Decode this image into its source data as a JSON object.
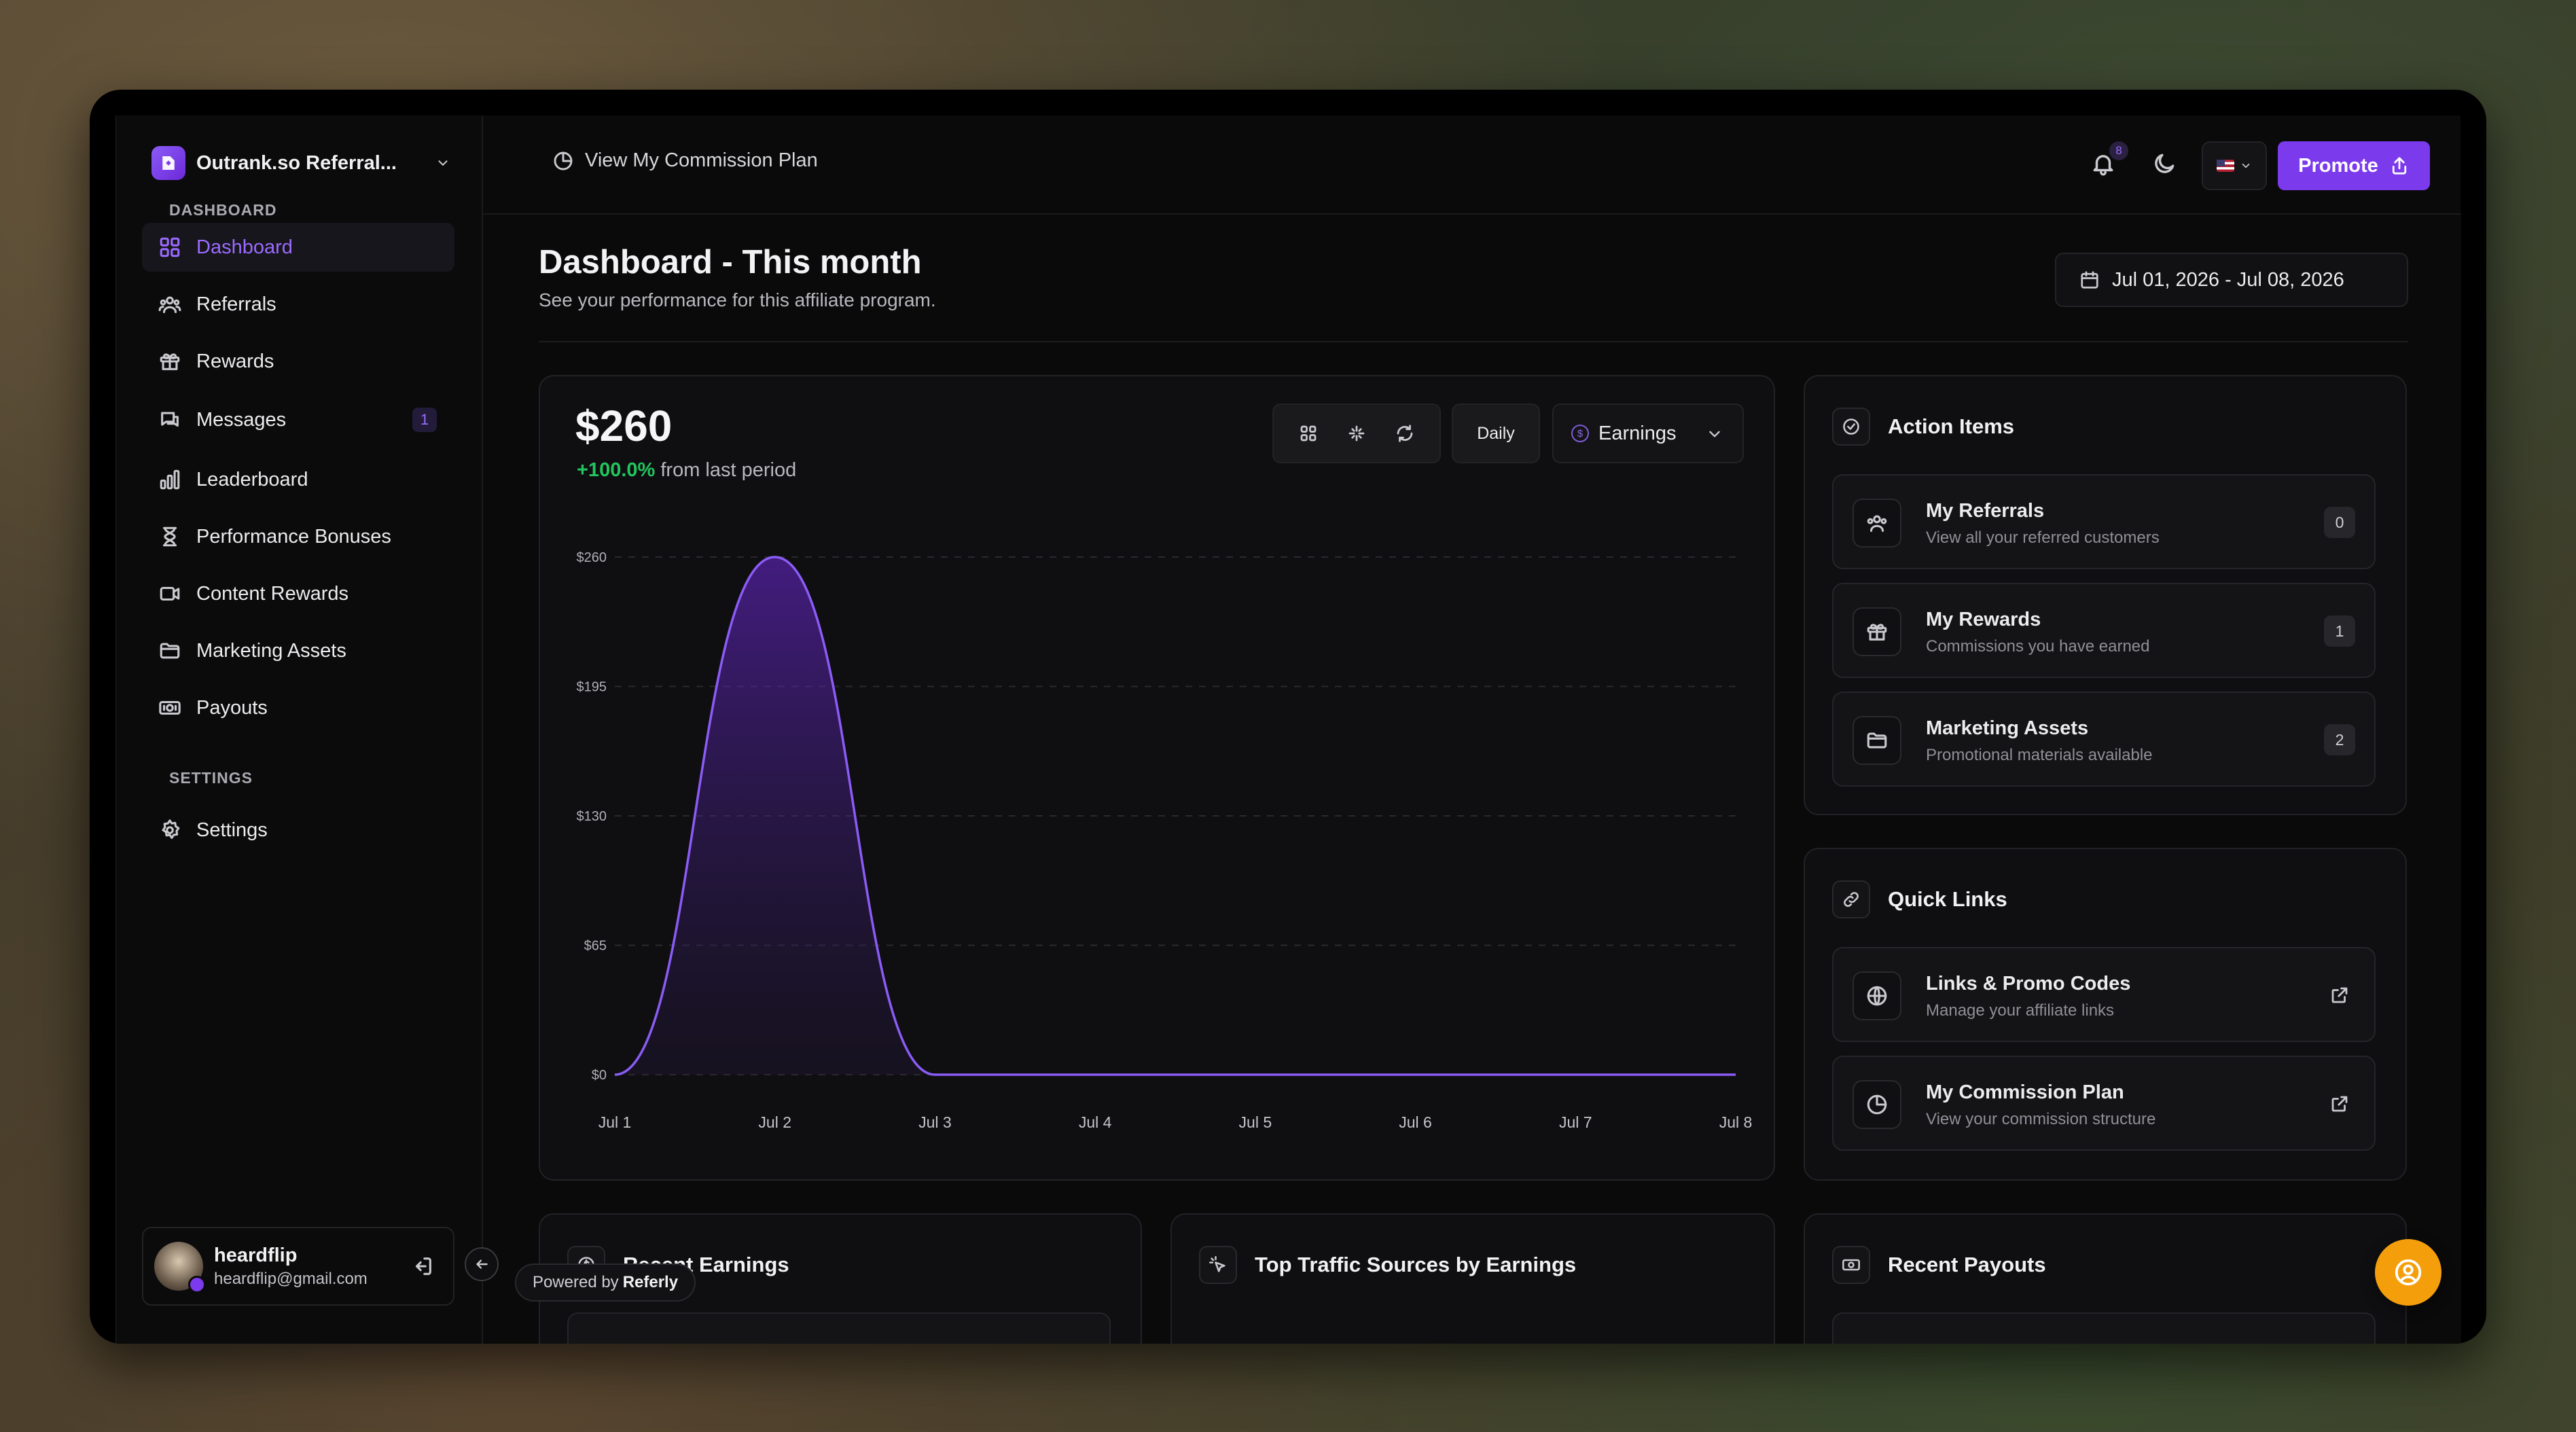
{
  "sidebar": {
    "brand": "Outrank.so Referral...",
    "section_dashboard": "DASHBOARD",
    "section_settings": "SETTINGS",
    "items": [
      {
        "label": "Dashboard",
        "icon": "grid-icon",
        "active": true
      },
      {
        "label": "Referrals",
        "icon": "users-icon"
      },
      {
        "label": "Rewards",
        "icon": "gift-icon"
      },
      {
        "label": "Messages",
        "icon": "message-icon",
        "badge": "1"
      },
      {
        "label": "Leaderboard",
        "icon": "bar-chart-icon"
      },
      {
        "label": "Performance Bonuses",
        "icon": "hourglass-icon"
      },
      {
        "label": "Content Rewards",
        "icon": "video-icon"
      },
      {
        "label": "Marketing Assets",
        "icon": "folder-icon"
      },
      {
        "label": "Payouts",
        "icon": "banknote-icon"
      }
    ],
    "settings_label": "Settings",
    "user": {
      "name": "heardflip",
      "email": "heardflip@gmail.com"
    }
  },
  "topbar": {
    "commission_link": "View My Commission Plan",
    "notification_count": "8",
    "promote_label": "Promote"
  },
  "page": {
    "title": "Dashboard - This month",
    "subtitle": "See your performance for this affiliate program.",
    "date_range": "Jul 01, 2026 - Jul 08, 2026"
  },
  "earnings_card": {
    "total": "$260",
    "change_pct": "+100.0%",
    "change_suffix": "from last period",
    "interval": "Daily",
    "metric": "Earnings"
  },
  "chart_data": {
    "type": "area",
    "x": [
      "Jul 1",
      "Jul 2",
      "Jul 3",
      "Jul 4",
      "Jul 5",
      "Jul 6",
      "Jul 7",
      "Jul 8"
    ],
    "values": [
      0,
      260,
      0,
      0,
      0,
      0,
      0,
      0
    ],
    "yticks": [
      "$0",
      "$65",
      "$130",
      "$195",
      "$260"
    ],
    "ylim": [
      0,
      260
    ],
    "grid": true,
    "color": "#8b5cf6"
  },
  "action_items": {
    "title": "Action Items",
    "items": [
      {
        "title": "My Referrals",
        "subtitle": "View all your referred customers",
        "count": "0"
      },
      {
        "title": "My Rewards",
        "subtitle": "Commissions you have earned",
        "count": "1"
      },
      {
        "title": "Marketing Assets",
        "subtitle": "Promotional materials available",
        "count": "2"
      }
    ]
  },
  "quick_links": {
    "title": "Quick Links",
    "items": [
      {
        "title": "Links & Promo Codes",
        "subtitle": "Manage your affiliate links"
      },
      {
        "title": "My Commission Plan",
        "subtitle": "View your commission structure"
      }
    ]
  },
  "bottom_cards": {
    "recent_earnings": "Recent Earnings",
    "top_traffic": "Top Traffic Sources by Earnings",
    "recent_payouts": "Recent Payouts"
  },
  "powered_by": {
    "prefix": "Powered by",
    "brand": "Referly"
  },
  "colors": {
    "accent": "#7c3aed",
    "positive": "#22c55e",
    "fab": "#f59e0b"
  }
}
